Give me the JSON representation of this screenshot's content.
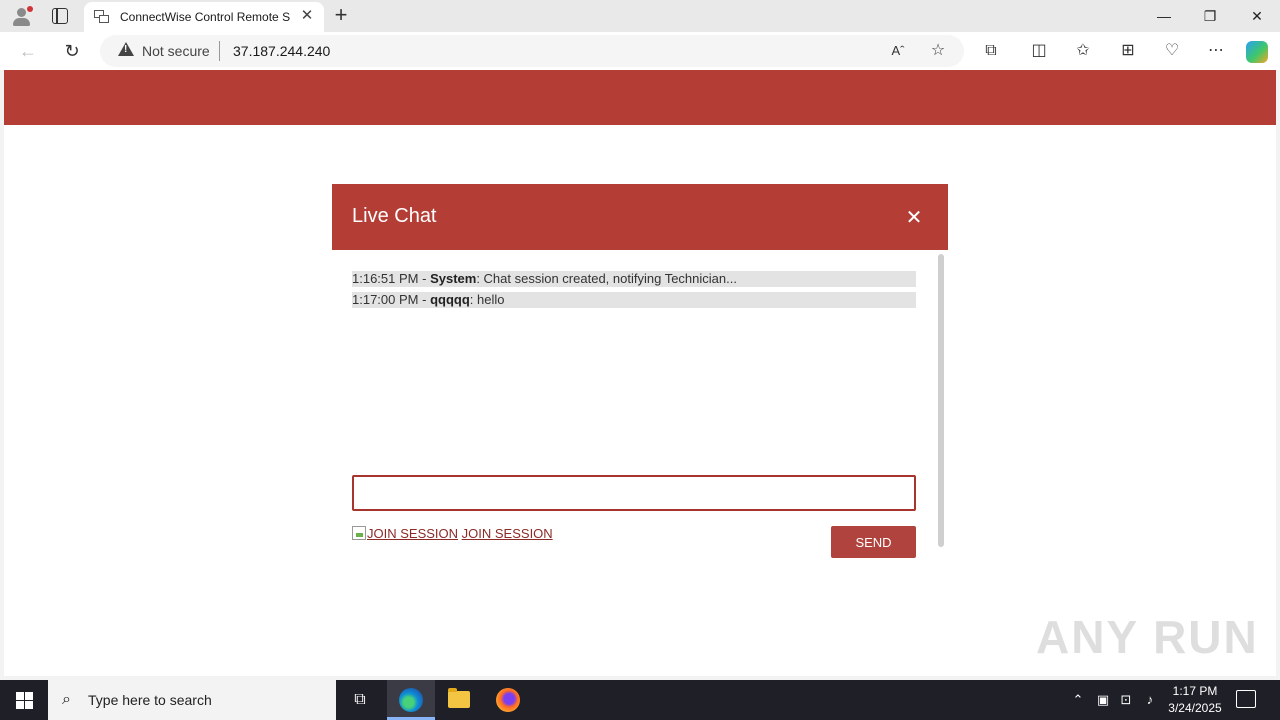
{
  "browser": {
    "tab_title": "ConnectWise Control Remote Su",
    "tab_close": "✕",
    "new_tab": "+",
    "window_minimize": "—",
    "window_restore": "❐",
    "window_close": "✕",
    "back": "←",
    "refresh": "↻",
    "security_label": "Not secure",
    "url": "37.187.244.240",
    "icons": [
      "read-aloud-icon",
      "favorite-icon",
      "extensions-icon",
      "split-screen-icon",
      "favorites-icon",
      "collections-icon",
      "browser-essentials-icon",
      "more-icon",
      "copilot-icon"
    ]
  },
  "chat": {
    "title": "Live Chat",
    "close_label": "✕",
    "messages": [
      {
        "time": "1:16:51 PM",
        "sender": "System",
        "text": "Chat session created, notifying Technician..."
      },
      {
        "time": "1:17:00 PM",
        "sender": "qqqqq",
        "text": "hello"
      }
    ],
    "input_value": "",
    "join_image_alt": "JOIN SESSION",
    "join_link": "JOIN SESSION",
    "send_label": "SEND"
  },
  "watermark": "ANY RUN",
  "taskbar": {
    "search_placeholder": "Type here to search",
    "time": "1:17 PM",
    "date": "3/24/2025",
    "apps": [
      "task-view",
      "edge",
      "file-explorer",
      "firefox"
    ],
    "colors": {
      "taskbar": "#1f1f28",
      "accent": "#b43d36"
    }
  }
}
